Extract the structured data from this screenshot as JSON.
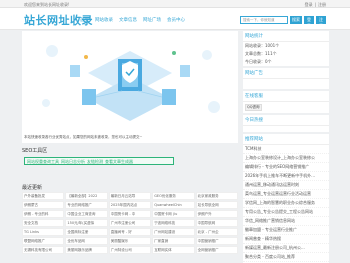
{
  "topbar": {
    "welcome": "欢迎您来到站长网址收录!",
    "login": "登录",
    "register": "注册"
  },
  "header": {
    "logo": "站长网址收录",
    "nav": [
      "首页",
      "网站收录",
      "文章信息",
      "网址广场",
      "会员中心"
    ],
    "search_placeholder": "搜索一下，你就知道",
    "search_btn": "搜索",
    "login_btn": "登录",
    "reg_btn": "注册"
  },
  "hero": {
    "caption": "本站快速收录各行业优秀站点，如果您的网站未被收录，您也可以主动提交~"
  },
  "seo": {
    "title": "SEO工具区",
    "tools": [
      "网站权重查询工具",
      "网站日志分析",
      "友链检测",
      "查看文章生成器"
    ]
  },
  "recent": {
    "title": "最近更新",
    "cells": [
      "户外装备批发",
      "【最新全部】2022",
      "最新日月云站导",
      "GEO优化服务",
      "北京家政服务",
      "伊朗蒙古",
      "专业的网络推广",
      "2025年国内站点",
      "QuanwheelChin",
      "站长导航全网",
      "伊朗 - 专业的科",
      "中国企业工商查询",
      "中国贺卡网 - 中",
      "中国贺卡网 (lu",
      "伊朗户外",
      "安全文档",
      "150元/年(买虚拟",
      "广州市注册公司",
      "宁波网络科技",
      "中国导航网",
      "TG Links",
      "全国商标注册",
      "直播间号 - 好",
      "广州网站建设",
      "北京 - 广州企",
      "联盟网络推广",
      "全优车品网",
      "美丽酷娱乐",
      "厂家直销",
      "中国营销推广",
      "无锡科技有限公司",
      "美丽网娱乐品牌",
      "广州特设公司",
      "互联网实体",
      "全网营销推广"
    ]
  },
  "sidebar": {
    "stats": {
      "title": "网站统计",
      "site_count": "网站收录：1001个",
      "article_count": "文章总数：111个",
      "today": "今日收录：0个"
    },
    "ads_title": "网站广告",
    "online": {
      "title": "在线客服",
      "qq": "QQ咨询"
    },
    "today_rec": {
      "title": "今日热搜"
    },
    "rank": {
      "title": "推荐网站",
      "items": [
        "TCM科技",
        "上海办公室装修设计_上海办公室装修公",
        "编辑排行 - 专业的SEO网络营销推广",
        "2026年手机上推车不断更新中手机外...",
        "通州运营_移动通讯店运营时刻",
        "菜鸟运营_专业运营运营行业活动运营",
        "学信网_上海的智慧的职业办公综合服务",
        "专用公告_专业公告提交_工程公告网站",
        "华信_网络推广营销信息网站",
        "徽章加盟 - 专业运营行业推广",
        "新闻普查 - 精华热搜",
        "新媒运营_最新注册公司_杭州公...",
        "聚合分类 - 百度公司站_推荐",
        "站长之家 - 全站 - 网站有效..."
      ]
    }
  },
  "colors": {
    "brand": "#37a7d6",
    "accent": "#2db47a"
  }
}
